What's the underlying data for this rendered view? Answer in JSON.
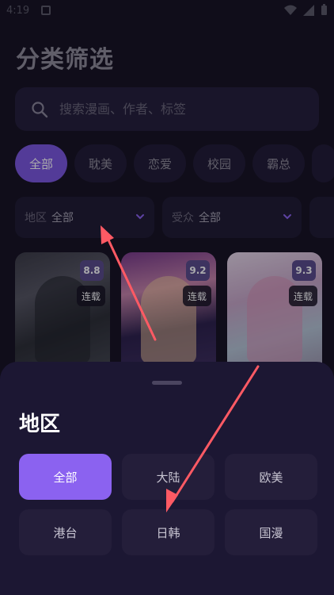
{
  "status_bar": {
    "time": "4:19"
  },
  "page": {
    "title": "分类筛选"
  },
  "search": {
    "placeholder": "搜索漫画、作者、标签"
  },
  "categories": [
    "全部",
    "耽美",
    "恋爱",
    "校园",
    "霸总"
  ],
  "filters": [
    {
      "label": "地区",
      "value": "全部"
    },
    {
      "label": "受众",
      "value": "全部"
    }
  ],
  "comics": [
    {
      "score": "8.8",
      "status": "连载"
    },
    {
      "score": "9.2",
      "status": "连载"
    },
    {
      "score": "9.3",
      "status": "连载"
    }
  ],
  "sheet": {
    "title": "地区",
    "options": [
      "全部",
      "大陆",
      "欧美",
      "港台",
      "日韩",
      "国漫"
    ],
    "selected": "全部"
  },
  "colors": {
    "accent": "#7c56e0",
    "background": "#14101f",
    "annotation_arrow": "#ff5a64"
  }
}
